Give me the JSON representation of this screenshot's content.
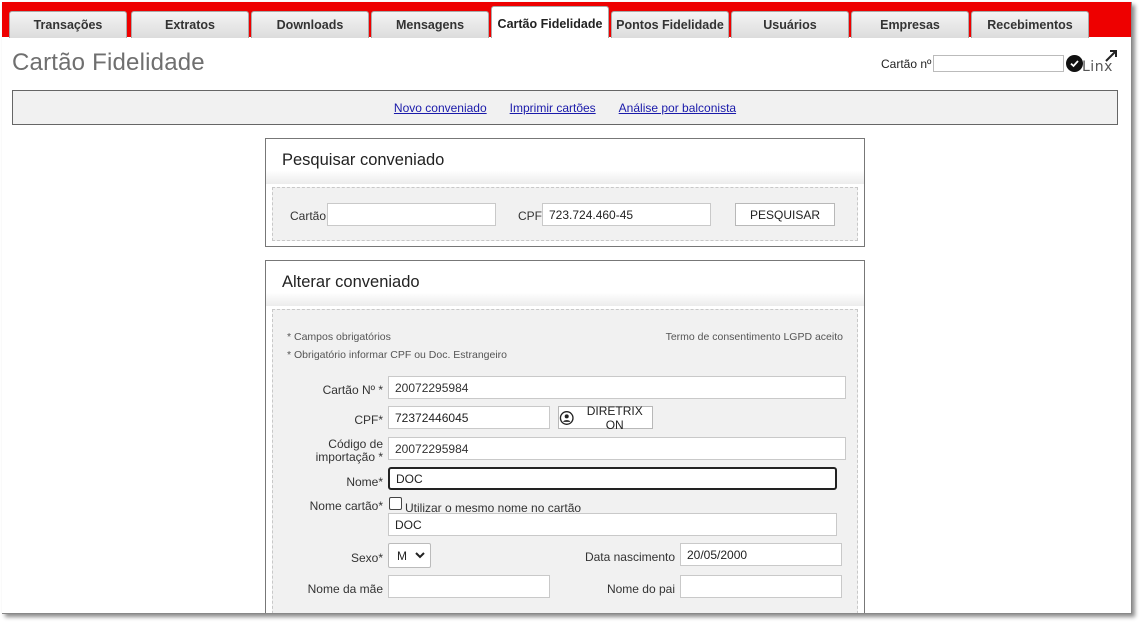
{
  "tabs": [
    {
      "label": "Transações",
      "active": false
    },
    {
      "label": "Extratos",
      "active": false
    },
    {
      "label": "Downloads",
      "active": false
    },
    {
      "label": "Mensagens",
      "active": false
    },
    {
      "label": "Cartão Fidelidade",
      "active": true
    },
    {
      "label": "Pontos Fidelidade",
      "active": false
    },
    {
      "label": "Usuários",
      "active": false
    },
    {
      "label": "Empresas",
      "active": false
    },
    {
      "label": "Recebimentos",
      "active": false
    }
  ],
  "page": {
    "title": "Cartão Fidelidade"
  },
  "header": {
    "card_label": "Cartão nº",
    "card_value": "",
    "logo_text": "Linx"
  },
  "links": {
    "new": "Novo conveniado",
    "print": "Imprimir cartões",
    "analysis": "Análise por balconista"
  },
  "search": {
    "title": "Pesquisar conveniado",
    "card_label": "Cartão",
    "card_value": "",
    "cpf_label": "CPF",
    "cpf_value": "723.724.460-45",
    "button": "PESQUISAR"
  },
  "edit": {
    "title": "Alterar conveniado",
    "note_required": "* Campos obrigatórios",
    "note_cpf": "* Obrigatório informar CPF ou Doc. Estrangeiro",
    "consent": "Termo de consentimento LGPD aceito",
    "card_label": "Cartão Nº *",
    "card_value": "20072295984",
    "cpf_label": "CPF*",
    "cpf_value": "72372446045",
    "diretrix_label": "DIRETRIX ON",
    "import_label_1": "Código de",
    "import_label_2": "importação *",
    "import_value": "20072295984",
    "name_label": "Nome*",
    "name_value": "DOC",
    "card_name_label": "Nome cartão*",
    "same_name_label": "Utilizar o mesmo nome no cartão",
    "same_name_checked": false,
    "card_name_value": "DOC",
    "sex_label": "Sexo*",
    "sex_value": "M",
    "birth_label": "Data nascimento",
    "birth_value": "20/05/2000",
    "mother_label": "Nome da mãe",
    "mother_value": "",
    "father_label": "Nome do pai",
    "father_value": ""
  }
}
